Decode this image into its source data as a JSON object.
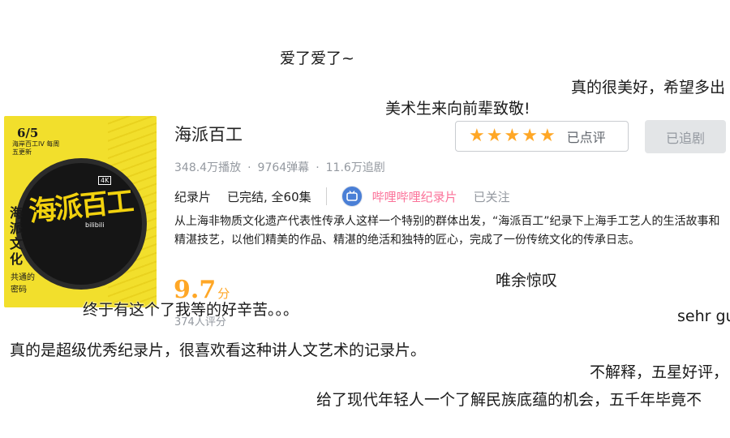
{
  "show": {
    "title": "海派百工",
    "stats": {
      "plays": "348.4万播放",
      "danmaku": "9764弹幕",
      "follows": "11.6万追剧"
    },
    "category": "纪录片",
    "status": "已完结, 全60集",
    "channel": "哔哩哔哩纪录片",
    "channel_follow_state": "已关注",
    "description": "从上海非物质文化遗产代表性传承人这样一个特别的群体出发，“海派百工”纪录下上海手工艺人的生活故事和精湛技艺，以他们精美的作品、精湛的绝活和独特的匠心，完成了一份传统文化的传承日志。",
    "score": "9.7",
    "score_unit": "分",
    "review_count": "374人评分"
  },
  "actions": {
    "rating_stars": 5,
    "rated_label": "已点评",
    "follow_label": "已追剧"
  },
  "cover": {
    "date": "6/5",
    "date_sub": "海岸百工IV 每周五更新",
    "title": "海派百工",
    "badge": "4K",
    "vertical_text": "海派文化",
    "vertical_small": "共通的密码",
    "producer": "bilibili"
  },
  "danmaku": [
    {
      "id": "d1",
      "text": "爱了爱了~"
    },
    {
      "id": "d2",
      "text": "真的很美好，希望多出"
    },
    {
      "id": "d3",
      "text": "美术生来向前辈致敬!"
    },
    {
      "id": "d4",
      "text": "唯余惊叹"
    },
    {
      "id": "d5",
      "text": "终于有这个了我等的好辛苦。。。"
    },
    {
      "id": "d6",
      "text": "sehr gu"
    },
    {
      "id": "d7",
      "text": "真的是超级优秀纪录片，很喜欢看这种讲人文艺术的记录片。"
    },
    {
      "id": "d8",
      "text": "不解释，五星好评，"
    },
    {
      "id": "d9",
      "text": "给了现代年轻人一个了解民族底蕴的机会，五千年毕竟不"
    }
  ],
  "colors": {
    "score": "#ffa726",
    "channel": "#fb7299",
    "muted": "#9499a0",
    "cover_bg": "#f2df2c"
  }
}
